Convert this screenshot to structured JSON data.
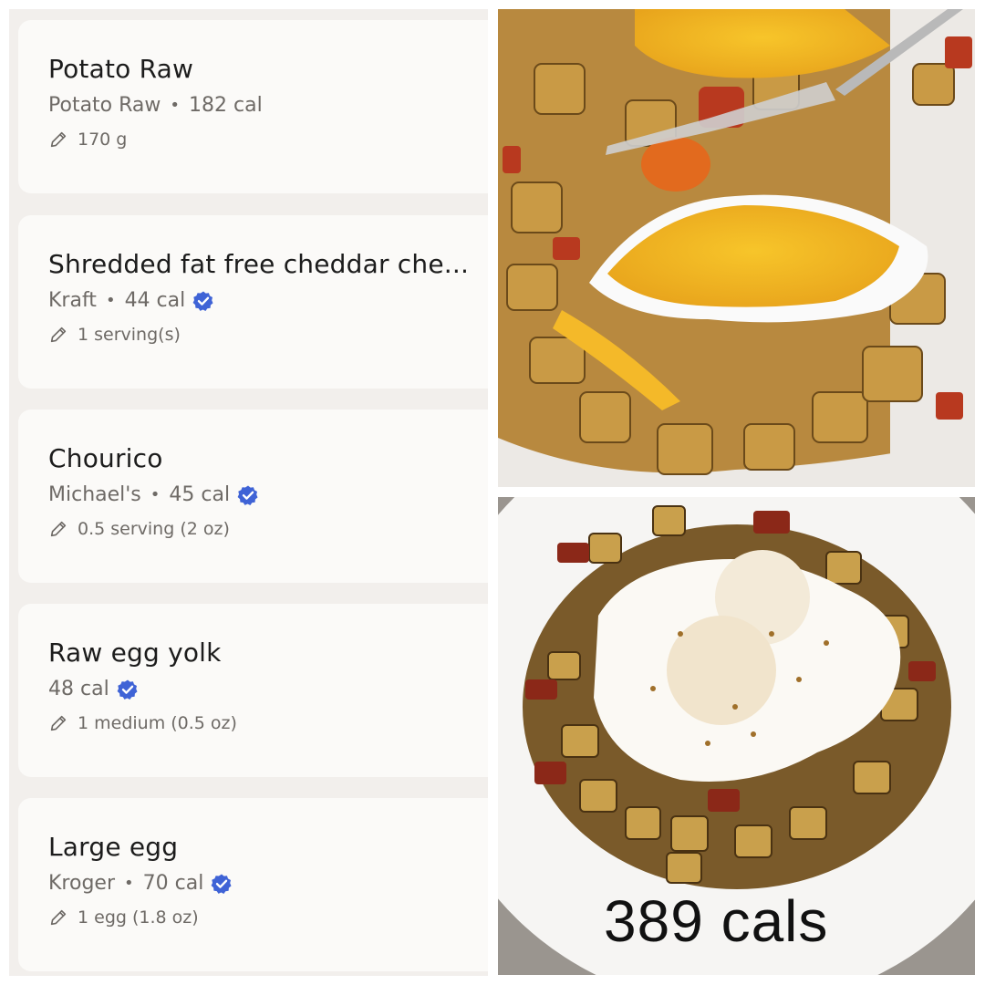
{
  "colors": {
    "panel_bg": "#f2efec",
    "card_bg": "#fbfaf8",
    "name_text": "#1c1c1c",
    "meta_text": "#6e6a66",
    "verified_blue": "#3f63d6"
  },
  "log": {
    "items": [
      {
        "name": "Potato Raw",
        "brand": "Potato Raw",
        "calories": "182 cal",
        "verified": false,
        "serving": "170 g"
      },
      {
        "name": "Shredded fat free cheddar che...",
        "brand": "Kraft",
        "calories": "44 cal",
        "verified": true,
        "serving": "1 serving(s)"
      },
      {
        "name": "Chourico",
        "brand": "Michael's",
        "calories": "45 cal",
        "verified": true,
        "serving": "0.5 serving (2 oz)"
      },
      {
        "name": "Raw egg yolk",
        "brand": "",
        "calories": "48 cal",
        "verified": true,
        "serving": "1 medium (0.5 oz)"
      },
      {
        "name": "Large egg",
        "brand": "Kroger",
        "calories": "70 cal",
        "verified": true,
        "serving": "1 egg (1.8 oz)"
      }
    ]
  },
  "photos": {
    "top_subject": "potato hash with melted cheddar and fried egg on fork",
    "bottom_subject": "bowl of potato chourico hash topped with fried eggs",
    "calorie_total": "389 cals"
  }
}
